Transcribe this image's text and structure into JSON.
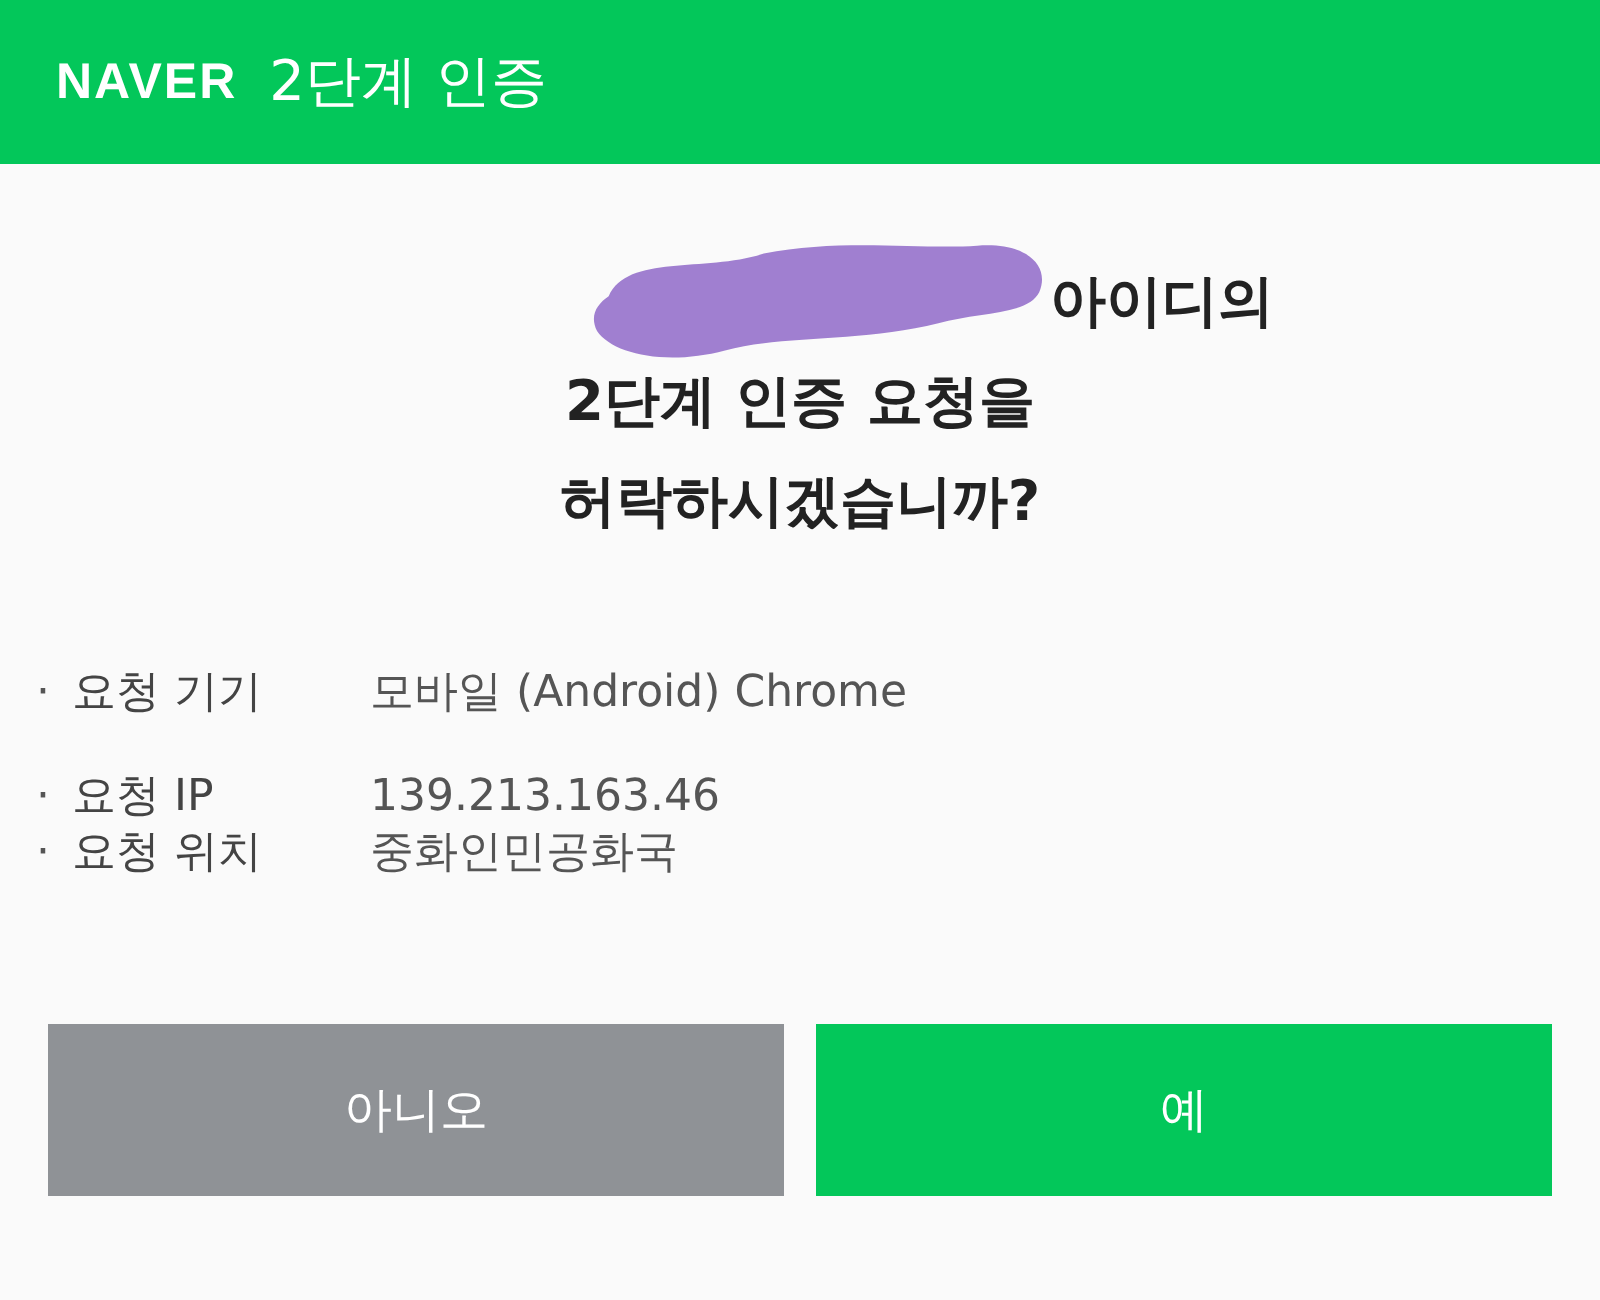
{
  "header": {
    "logo": "NAVER",
    "title": "2단계 인증"
  },
  "question": {
    "id_redacted": true,
    "lines": [
      "아이디의",
      "2단계 인증 요청을",
      "허락하시겠습니까?"
    ]
  },
  "details": [
    {
      "bullet": "·",
      "label": "요청 기기",
      "value": "모바일 (Android) Chrome"
    },
    {
      "bullet": "·",
      "label": "요청 IP",
      "value": "139.213.163.46"
    },
    {
      "bullet": "·",
      "label": "요청 위치",
      "value": "중화인민공화국"
    }
  ],
  "buttons": [
    {
      "label": "아니오",
      "kind": "secondary"
    },
    {
      "label": "예",
      "kind": "primary"
    }
  ]
}
